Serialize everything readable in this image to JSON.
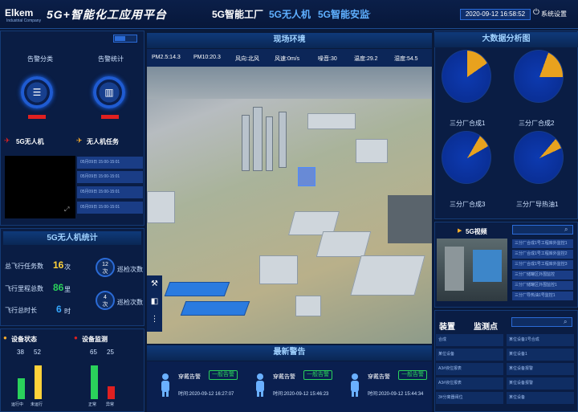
{
  "header": {
    "logo": "Elkem",
    "logo_sub": "Industrial Company",
    "title": "5G+智能化工应用平台",
    "nav": [
      "5G智能工厂",
      "5G无人机",
      "5G智能安监"
    ],
    "datetime": "2020-09-12 16:58:52",
    "system_settings": "系统设置"
  },
  "left": {
    "alarm_class": "告警分类",
    "alarm_stats": "告警统计",
    "drone_title": "5G无人机",
    "mission_title": "无人机任务",
    "missions": [
      "05月09日 15:00-15:01",
      "05月09日 15:00-15:01",
      "05月09日 15:00-15:01",
      "05月09日 15:00-15:01"
    ],
    "stats_title": "5G无人机统计",
    "stats": [
      {
        "label": "总飞行任务数",
        "value": "16",
        "unit": "次",
        "color": "#ffd23a"
      },
      {
        "label": "飞行里程总数",
        "value": "86",
        "unit": "里",
        "color": "#2ad15b"
      },
      {
        "label": "飞行总时长",
        "value": "6",
        "unit": "时",
        "color": "#35a8ff"
      }
    ],
    "rings": [
      {
        "value": "12",
        "unit": "次",
        "label": "巡检次数"
      },
      {
        "value": "4",
        "unit": "次",
        "label": "巡检次数"
      }
    ],
    "device_status": "设备状态",
    "device_monitor": "设备监测",
    "status_counts": [
      "38",
      "52"
    ],
    "monitor_counts": [
      "65",
      "25"
    ],
    "status_bars": [
      0.5,
      0.8
    ],
    "monitor_bars": [
      0.8,
      0.3
    ],
    "bar_labels": [
      "运行中",
      "未运行",
      "正常",
      "异常"
    ]
  },
  "center": {
    "env_title": "现场环境",
    "env": [
      "PM2.5:14.3",
      "PM10:20.3",
      "风向:北风",
      "风速:0m/s",
      "噪音:30",
      "温度:29.2",
      "湿度:54.5"
    ],
    "alarm_title": "最新警告",
    "alarms": [
      {
        "type": "穿戴告警",
        "level": "一般告警",
        "time": "时间:2020-09-12 16:27:07"
      },
      {
        "type": "穿戴告警",
        "level": "一般告警",
        "time": "时间:2020-09-12 15:46:23"
      },
      {
        "type": "穿戴告警",
        "level": "一般告警",
        "time": "时间:2020-09-12 15:44:34"
      }
    ]
  },
  "right": {
    "bigdata_title": "大数据分析图",
    "radars": [
      "三分厂合成1",
      "三分厂合成2",
      "三分厂合成3",
      "三分厂导热油1"
    ],
    "video_title": "5G视频",
    "video_items": [
      "三分厂合成1号工程库外监控1",
      "三分厂合成1号工程库外监控2",
      "三分厂合成1号工程库外监控3",
      "三分厂储罐区外围监控",
      "三分厂储罐区外围监控1",
      "三分厂导热油1号监控1"
    ],
    "device_tab": "装置",
    "monitor_tab": "监测点",
    "device_left": [
      "合成",
      "某位设备",
      "A3#液位报表",
      "A3#液位报表",
      "3#分离器阀位"
    ],
    "device_right": [
      "某位设备1号合成",
      "某位设备1",
      "某位设备报警",
      "某位设备报警",
      "某位设备"
    ]
  },
  "colors": {
    "accent": "#2b6bd6",
    "green": "#2ad15b",
    "red": "#e02020",
    "yellow": "#ffd23a"
  }
}
